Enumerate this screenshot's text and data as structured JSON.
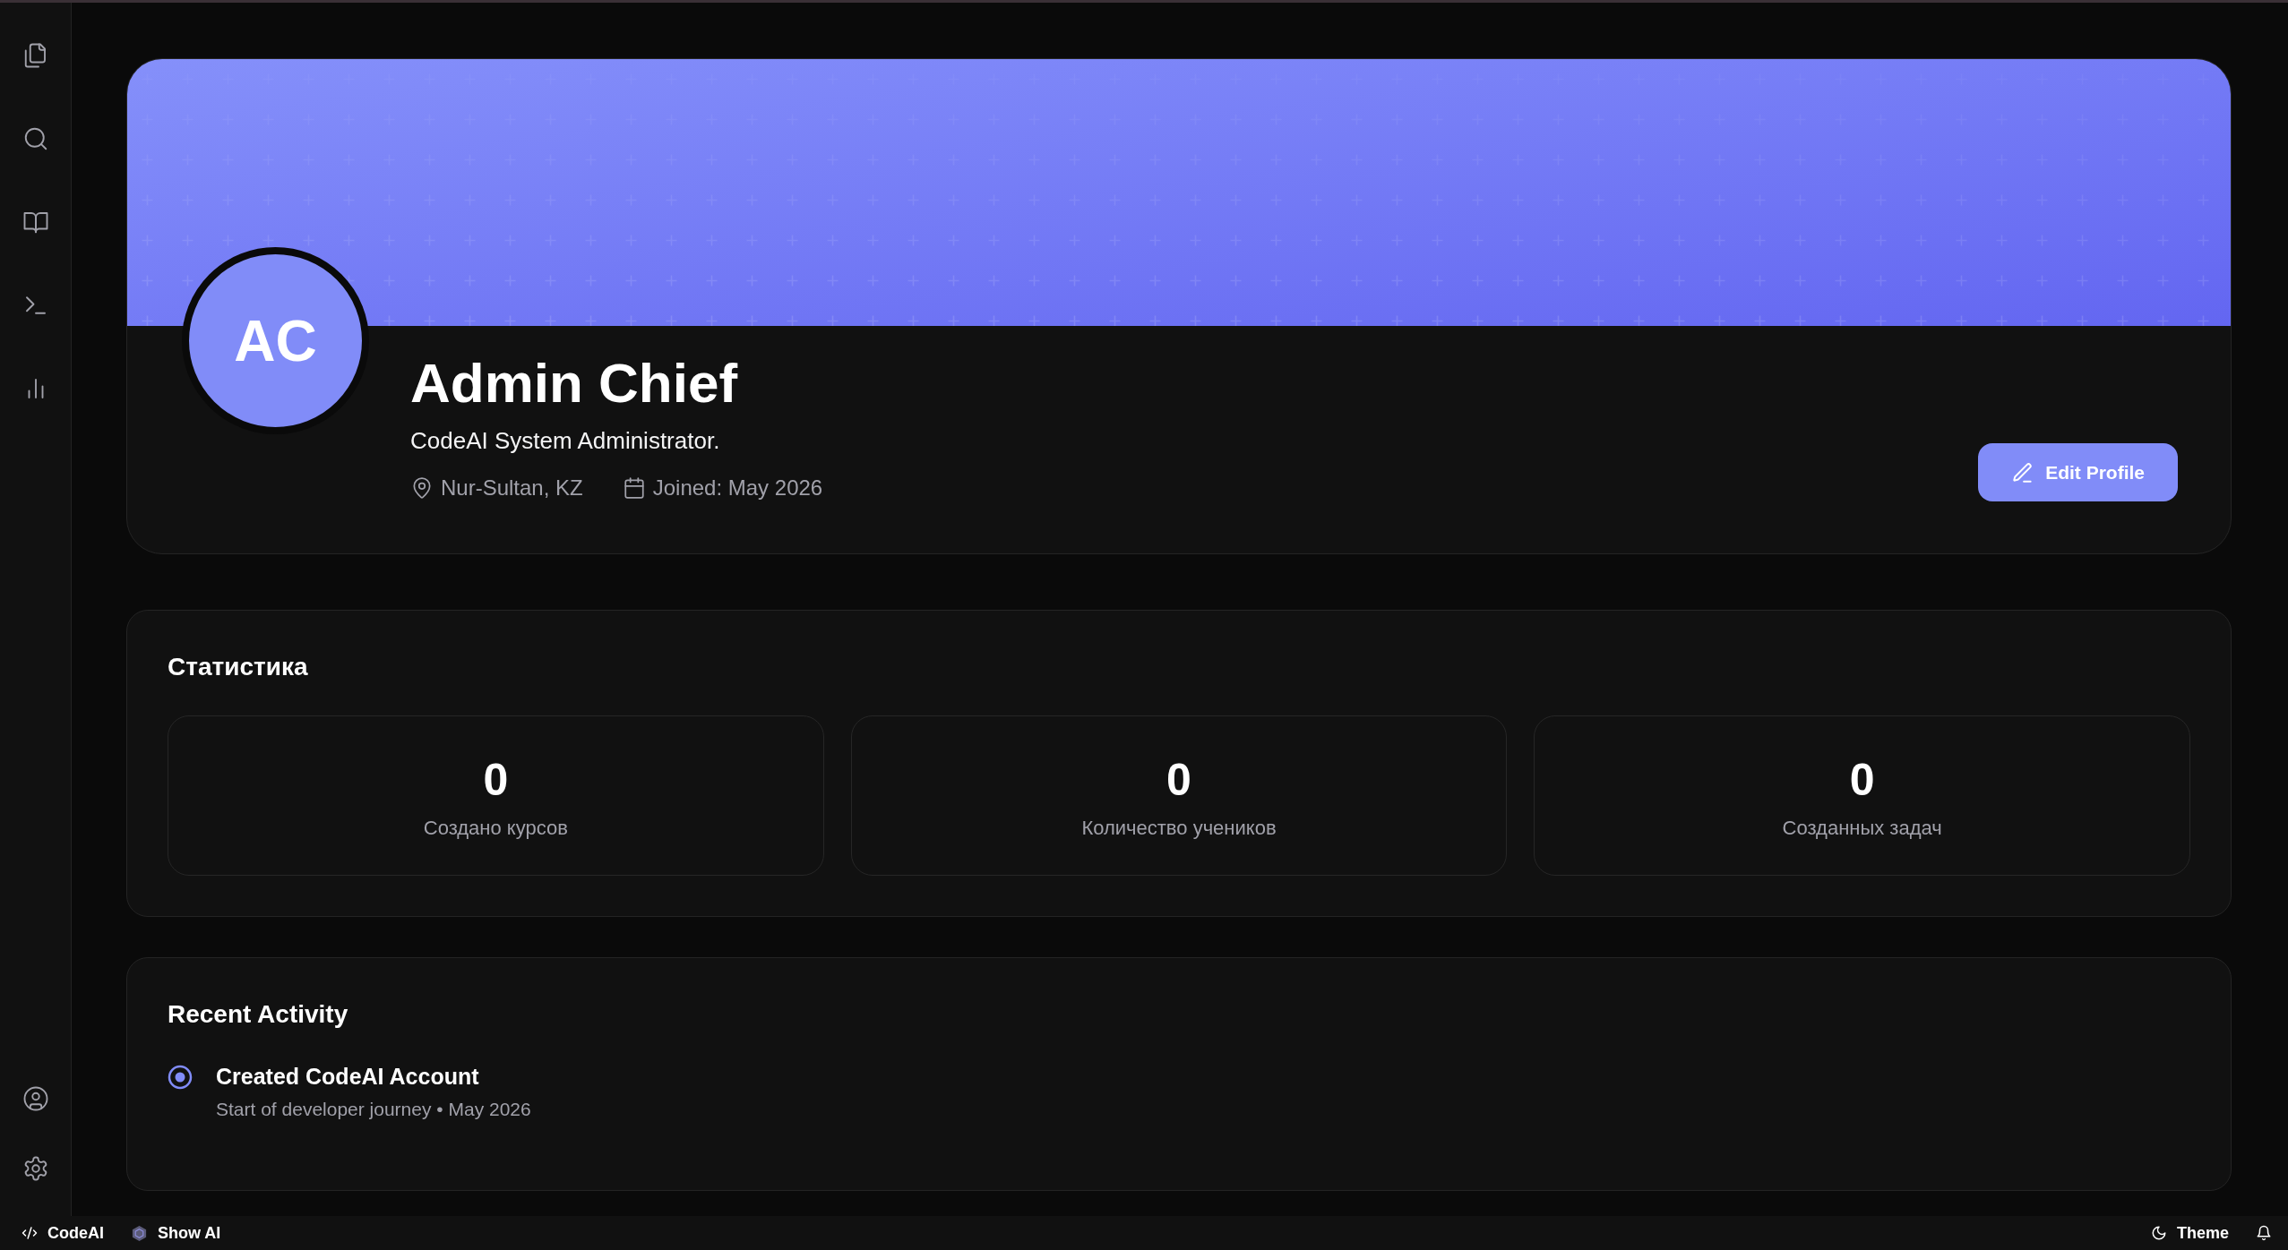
{
  "profile": {
    "avatar_initials": "AC",
    "name": "Admin Chief",
    "bio": "CodeAI System Administrator.",
    "location": "Nur-Sultan, KZ",
    "joined": "Joined: May 2026",
    "edit_button": "Edit Profile"
  },
  "statistics": {
    "title": "Статистика",
    "items": [
      {
        "value": "0",
        "label": "Создано курсов"
      },
      {
        "value": "0",
        "label": "Количество учеников"
      },
      {
        "value": "0",
        "label": "Созданных задач"
      }
    ]
  },
  "recent_activity": {
    "title": "Recent Activity",
    "items": [
      {
        "title": "Created CodeAI Account",
        "subtitle": "Start of developer journey • May 2026"
      }
    ]
  },
  "status_bar": {
    "brand": "CodeAI",
    "ai_button": "Show AI",
    "theme_button": "Theme"
  }
}
